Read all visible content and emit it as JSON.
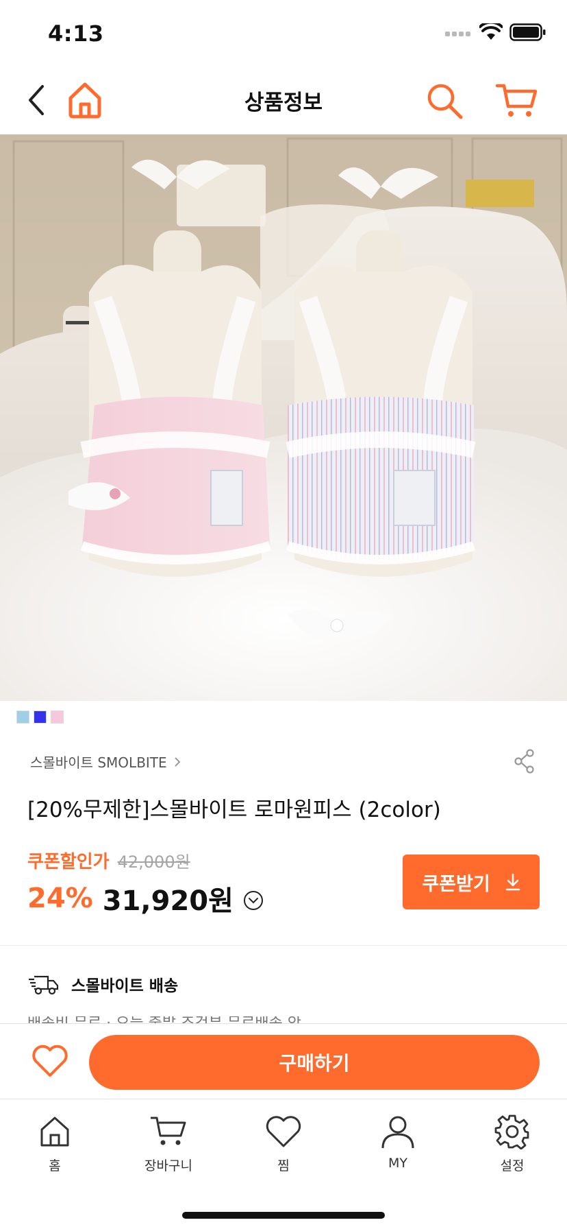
{
  "status_bar": {
    "time": "4:13",
    "icons": [
      "signal-icon",
      "wifi-icon",
      "battery-icon"
    ]
  },
  "top_nav": {
    "title": "상품정보",
    "icons": {
      "back": "chevron-left-icon",
      "home": "home-icon",
      "search": "search-icon",
      "cart": "cart-icon"
    },
    "accent_color": "#ff6b2c"
  },
  "gallery": {
    "image_count": 9,
    "active_index": 0,
    "image_alt": "Two lace-trimmed dog dresses on mannequins (pink and lavender stripes) on a white fur rug"
  },
  "color_swatches": [
    "#9ecfe6",
    "#3333ee",
    "#f7c7dc"
  ],
  "product": {
    "brand": "스몰바이트 SMOLBITE",
    "title": "[20%무제한]스몰바이트 로마원피스 (2color)",
    "coupon_label": "쿠폰할인가",
    "original_price": "42,000원",
    "discount_rate": "24%",
    "sale_price": "31,920원",
    "coupon_button_label": "쿠폰받기"
  },
  "delivery": {
    "label": "스몰바이트 배송",
    "peek_text": "배송비 무료 · 오늘 출발 조건부 무료배송 안내"
  },
  "purchase_bar": {
    "buy_label": "구매하기"
  },
  "tab_bar": {
    "items": [
      {
        "label": "홈",
        "icon": "home-icon"
      },
      {
        "label": "장바구니",
        "icon": "cart-icon"
      },
      {
        "label": "찜",
        "icon": "heart-icon"
      },
      {
        "label": "MY",
        "icon": "user-icon"
      },
      {
        "label": "설정",
        "icon": "gear-icon"
      }
    ]
  },
  "colors": {
    "accent": "#ff6b2c",
    "text_primary": "#111111",
    "text_muted": "#a5a5a5"
  }
}
